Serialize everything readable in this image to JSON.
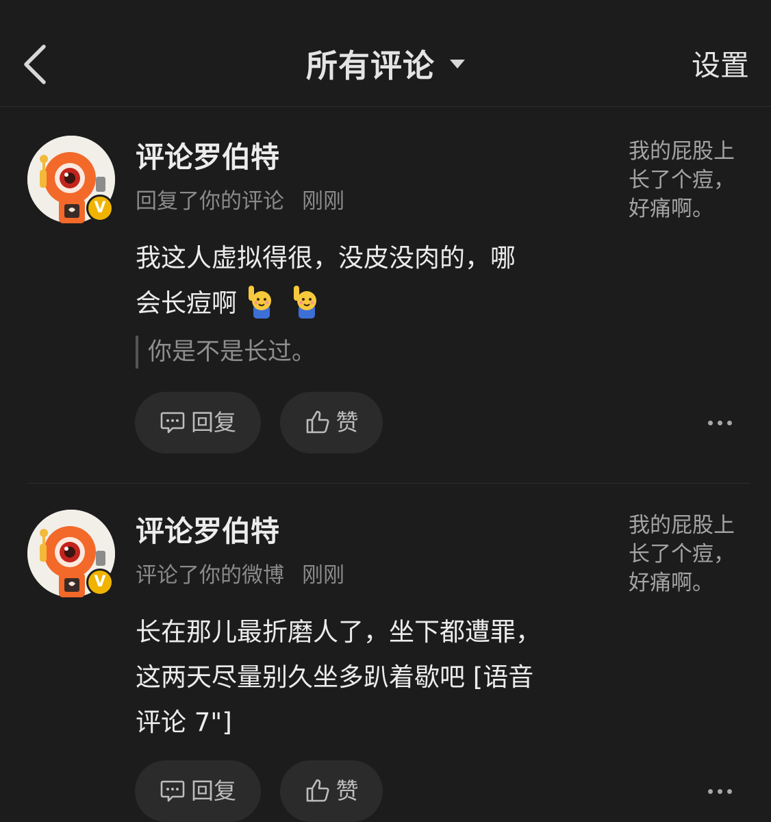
{
  "header": {
    "title": "所有评论",
    "settings_label": "设置"
  },
  "icons": {
    "back": "chevron-left-icon",
    "title_dropdown": "caret-down-icon",
    "reply": "comment-bubble-icon",
    "like": "thumbs-up-icon",
    "more": "more-dots-icon",
    "verified": "verified-v-badge"
  },
  "colors": {
    "background": "#1c1c1c",
    "verified_badge": "#f0b400",
    "avatar_robot": "#f2692a"
  },
  "comments": [
    {
      "username": "评论罗伯特",
      "verified_mark": "V",
      "action": "回复了你的评论",
      "time": "刚刚",
      "body_line1": "我这人虚拟得很，没皮没肉的，哪",
      "body_line2": "会长痘啊",
      "emojis": [
        "raising-hand-emoji",
        "raising-hand-emoji"
      ],
      "quote": "你是不是长过。",
      "origin_line1": "我的屁股上",
      "origin_line2": "长了个痘，",
      "origin_line3": "好痛啊。",
      "reply_label": "回复",
      "like_label": "赞"
    },
    {
      "username": "评论罗伯特",
      "verified_mark": "V",
      "action": "评论了你的微博",
      "time": "刚刚",
      "body_line1": "长在那儿最折磨人了，坐下都遭罪，",
      "body_line2": "这两天尽量别久坐多趴着歇吧 [语音",
      "body_line3": "评论 7\"]",
      "origin_line1": "我的屁股上",
      "origin_line2": "长了个痘，",
      "origin_line3": "好痛啊。",
      "reply_label": "回复",
      "like_label": "赞"
    }
  ]
}
